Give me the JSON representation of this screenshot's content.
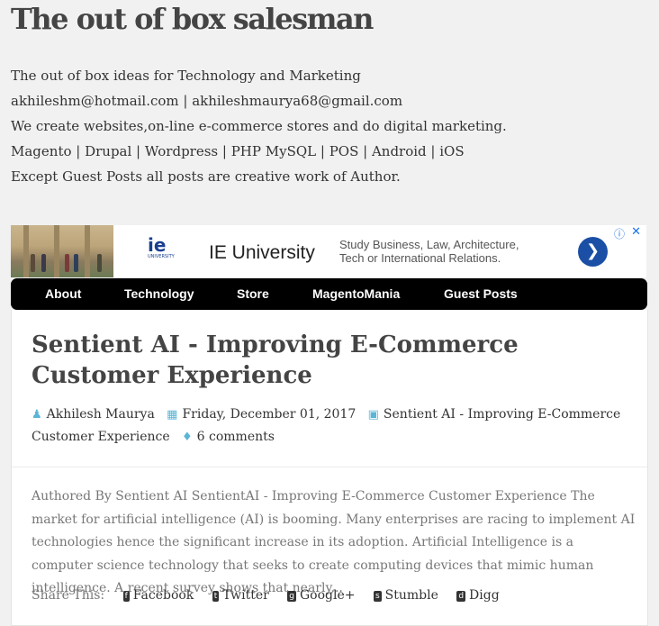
{
  "site": {
    "title": "The out of box salesman",
    "description": [
      "The out of box ideas for Technology and Marketing",
      "akhileshm@hotmail.com | akhileshmaurya68@gmail.com",
      "We create websites,on-line e-commerce stores and do digital marketing.",
      "Magento | Drupal | Wordpress | PHP MySQL | POS | Android | iOS",
      "Except Guest Posts all posts are creative work of Author."
    ]
  },
  "ad": {
    "brand": "IE University",
    "logo_text": "ie",
    "logo_sub": "UNIVERSITY",
    "text_line1": "Study Business, Law, Architecture,",
    "text_line2": "Tech or International Relations.",
    "go_icon": "chevron-right-icon",
    "info_icon": "info-icon",
    "close_icon": "close-icon"
  },
  "nav": {
    "items": [
      "About",
      "Technology",
      "Store",
      "MagentoMania",
      "Guest Posts"
    ]
  },
  "post": {
    "title": "Sentient AI - Improving E-Commerce Customer Experience",
    "author": "Akhilesh Maurya",
    "date": "Friday, December 01, 2017",
    "category": "Sentient AI - Improving E-Commerce Customer Experience",
    "comments": "6 comments",
    "excerpt": "Authored By Sentient AI SentientAI - Improving E-Commerce Customer Experience The market for artificial intelligence (AI) is booming. Many enterprises are racing to implement AI technologies hence the significant increase in its adoption. Artificial Intelligence is a computer science technology that seeks to create computing devices that mimic human intelligence. A recent survey shows that nearly..."
  },
  "share": {
    "label": "Share This:",
    "buttons": [
      "Facebook",
      "Twitter",
      "Google+",
      "Stumble",
      "Digg"
    ]
  },
  "colors": {
    "background": "#f1f1f1",
    "nav_bg": "#000000",
    "meta_icon": "#5ab5d6",
    "ad_button": "#1a4fa5"
  }
}
